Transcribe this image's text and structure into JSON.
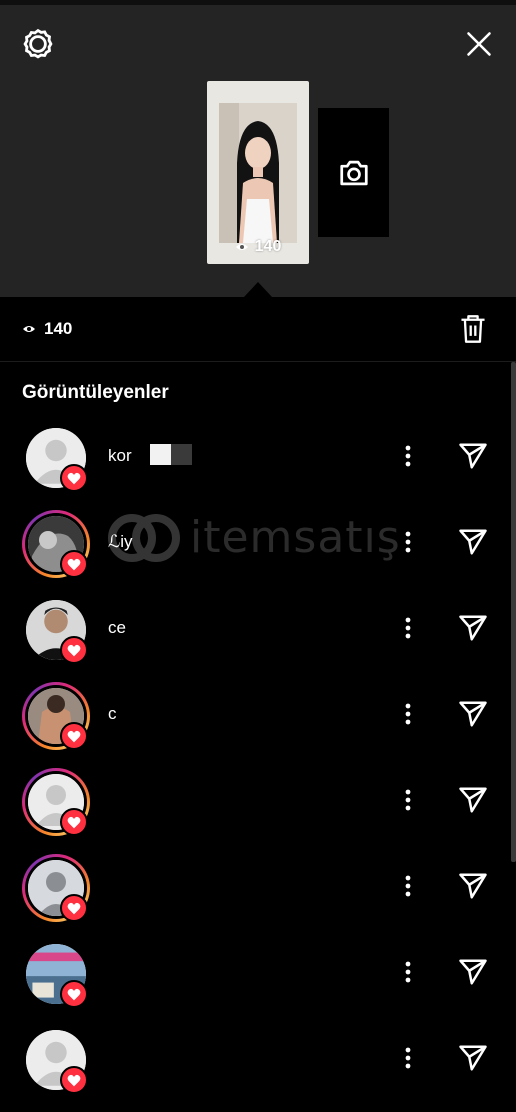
{
  "header": {
    "settings_icon": "gear-icon",
    "close_icon": "close-icon"
  },
  "story": {
    "views_count": "140",
    "camera_icon": "camera-icon"
  },
  "stats": {
    "views_count": "140",
    "delete_icon": "trash-icon"
  },
  "viewers_title": "Görüntüleyenler",
  "viewers": [
    {
      "username": "kor",
      "avatar": "default",
      "ring": false,
      "liked": true
    },
    {
      "username": "ℒiy",
      "avatar": "photo",
      "ring": true,
      "liked": true
    },
    {
      "username": "ce",
      "avatar": "photo",
      "ring": false,
      "liked": true
    },
    {
      "username": "c",
      "avatar": "photo",
      "ring": true,
      "liked": true
    },
    {
      "username": "",
      "avatar": "default",
      "ring": true,
      "liked": true
    },
    {
      "username": "",
      "avatar": "photo",
      "ring": true,
      "liked": true
    },
    {
      "username": "",
      "avatar": "photo",
      "ring": false,
      "liked": true
    },
    {
      "username": "",
      "avatar": "default",
      "ring": false,
      "liked": true
    }
  ],
  "watermark": {
    "text": "itemsatış"
  },
  "colors": {
    "heart": "#ff3040",
    "ring_start": "#f58529",
    "ring_end": "#dd2a7b",
    "top_bg": "#242424"
  }
}
